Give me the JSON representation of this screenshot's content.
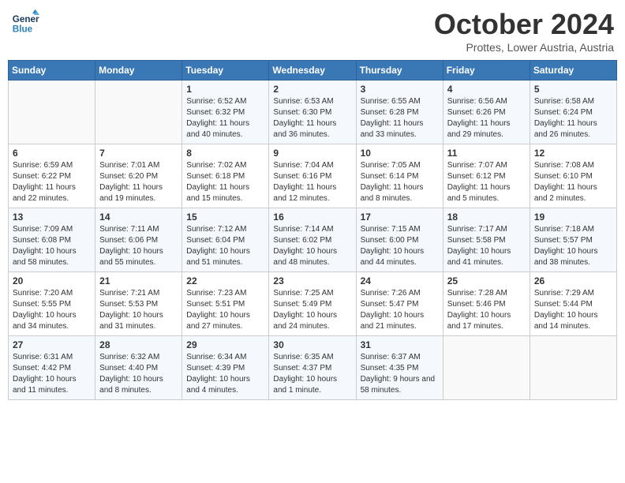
{
  "header": {
    "logo_general": "General",
    "logo_blue": "Blue",
    "month_title": "October 2024",
    "location": "Prottes, Lower Austria, Austria"
  },
  "weekdays": [
    "Sunday",
    "Monday",
    "Tuesday",
    "Wednesday",
    "Thursday",
    "Friday",
    "Saturday"
  ],
  "weeks": [
    [
      {
        "day": "",
        "sunrise": "",
        "sunset": "",
        "daylight": ""
      },
      {
        "day": "",
        "sunrise": "",
        "sunset": "",
        "daylight": ""
      },
      {
        "day": "1",
        "sunrise": "Sunrise: 6:52 AM",
        "sunset": "Sunset: 6:32 PM",
        "daylight": "Daylight: 11 hours and 40 minutes."
      },
      {
        "day": "2",
        "sunrise": "Sunrise: 6:53 AM",
        "sunset": "Sunset: 6:30 PM",
        "daylight": "Daylight: 11 hours and 36 minutes."
      },
      {
        "day": "3",
        "sunrise": "Sunrise: 6:55 AM",
        "sunset": "Sunset: 6:28 PM",
        "daylight": "Daylight: 11 hours and 33 minutes."
      },
      {
        "day": "4",
        "sunrise": "Sunrise: 6:56 AM",
        "sunset": "Sunset: 6:26 PM",
        "daylight": "Daylight: 11 hours and 29 minutes."
      },
      {
        "day": "5",
        "sunrise": "Sunrise: 6:58 AM",
        "sunset": "Sunset: 6:24 PM",
        "daylight": "Daylight: 11 hours and 26 minutes."
      }
    ],
    [
      {
        "day": "6",
        "sunrise": "Sunrise: 6:59 AM",
        "sunset": "Sunset: 6:22 PM",
        "daylight": "Daylight: 11 hours and 22 minutes."
      },
      {
        "day": "7",
        "sunrise": "Sunrise: 7:01 AM",
        "sunset": "Sunset: 6:20 PM",
        "daylight": "Daylight: 11 hours and 19 minutes."
      },
      {
        "day": "8",
        "sunrise": "Sunrise: 7:02 AM",
        "sunset": "Sunset: 6:18 PM",
        "daylight": "Daylight: 11 hours and 15 minutes."
      },
      {
        "day": "9",
        "sunrise": "Sunrise: 7:04 AM",
        "sunset": "Sunset: 6:16 PM",
        "daylight": "Daylight: 11 hours and 12 minutes."
      },
      {
        "day": "10",
        "sunrise": "Sunrise: 7:05 AM",
        "sunset": "Sunset: 6:14 PM",
        "daylight": "Daylight: 11 hours and 8 minutes."
      },
      {
        "day": "11",
        "sunrise": "Sunrise: 7:07 AM",
        "sunset": "Sunset: 6:12 PM",
        "daylight": "Daylight: 11 hours and 5 minutes."
      },
      {
        "day": "12",
        "sunrise": "Sunrise: 7:08 AM",
        "sunset": "Sunset: 6:10 PM",
        "daylight": "Daylight: 11 hours and 2 minutes."
      }
    ],
    [
      {
        "day": "13",
        "sunrise": "Sunrise: 7:09 AM",
        "sunset": "Sunset: 6:08 PM",
        "daylight": "Daylight: 10 hours and 58 minutes."
      },
      {
        "day": "14",
        "sunrise": "Sunrise: 7:11 AM",
        "sunset": "Sunset: 6:06 PM",
        "daylight": "Daylight: 10 hours and 55 minutes."
      },
      {
        "day": "15",
        "sunrise": "Sunrise: 7:12 AM",
        "sunset": "Sunset: 6:04 PM",
        "daylight": "Daylight: 10 hours and 51 minutes."
      },
      {
        "day": "16",
        "sunrise": "Sunrise: 7:14 AM",
        "sunset": "Sunset: 6:02 PM",
        "daylight": "Daylight: 10 hours and 48 minutes."
      },
      {
        "day": "17",
        "sunrise": "Sunrise: 7:15 AM",
        "sunset": "Sunset: 6:00 PM",
        "daylight": "Daylight: 10 hours and 44 minutes."
      },
      {
        "day": "18",
        "sunrise": "Sunrise: 7:17 AM",
        "sunset": "Sunset: 5:58 PM",
        "daylight": "Daylight: 10 hours and 41 minutes."
      },
      {
        "day": "19",
        "sunrise": "Sunrise: 7:18 AM",
        "sunset": "Sunset: 5:57 PM",
        "daylight": "Daylight: 10 hours and 38 minutes."
      }
    ],
    [
      {
        "day": "20",
        "sunrise": "Sunrise: 7:20 AM",
        "sunset": "Sunset: 5:55 PM",
        "daylight": "Daylight: 10 hours and 34 minutes."
      },
      {
        "day": "21",
        "sunrise": "Sunrise: 7:21 AM",
        "sunset": "Sunset: 5:53 PM",
        "daylight": "Daylight: 10 hours and 31 minutes."
      },
      {
        "day": "22",
        "sunrise": "Sunrise: 7:23 AM",
        "sunset": "Sunset: 5:51 PM",
        "daylight": "Daylight: 10 hours and 27 minutes."
      },
      {
        "day": "23",
        "sunrise": "Sunrise: 7:25 AM",
        "sunset": "Sunset: 5:49 PM",
        "daylight": "Daylight: 10 hours and 24 minutes."
      },
      {
        "day": "24",
        "sunrise": "Sunrise: 7:26 AM",
        "sunset": "Sunset: 5:47 PM",
        "daylight": "Daylight: 10 hours and 21 minutes."
      },
      {
        "day": "25",
        "sunrise": "Sunrise: 7:28 AM",
        "sunset": "Sunset: 5:46 PM",
        "daylight": "Daylight: 10 hours and 17 minutes."
      },
      {
        "day": "26",
        "sunrise": "Sunrise: 7:29 AM",
        "sunset": "Sunset: 5:44 PM",
        "daylight": "Daylight: 10 hours and 14 minutes."
      }
    ],
    [
      {
        "day": "27",
        "sunrise": "Sunrise: 6:31 AM",
        "sunset": "Sunset: 4:42 PM",
        "daylight": "Daylight: 10 hours and 11 minutes."
      },
      {
        "day": "28",
        "sunrise": "Sunrise: 6:32 AM",
        "sunset": "Sunset: 4:40 PM",
        "daylight": "Daylight: 10 hours and 8 minutes."
      },
      {
        "day": "29",
        "sunrise": "Sunrise: 6:34 AM",
        "sunset": "Sunset: 4:39 PM",
        "daylight": "Daylight: 10 hours and 4 minutes."
      },
      {
        "day": "30",
        "sunrise": "Sunrise: 6:35 AM",
        "sunset": "Sunset: 4:37 PM",
        "daylight": "Daylight: 10 hours and 1 minute."
      },
      {
        "day": "31",
        "sunrise": "Sunrise: 6:37 AM",
        "sunset": "Sunset: 4:35 PM",
        "daylight": "Daylight: 9 hours and 58 minutes."
      },
      {
        "day": "",
        "sunrise": "",
        "sunset": "",
        "daylight": ""
      },
      {
        "day": "",
        "sunrise": "",
        "sunset": "",
        "daylight": ""
      }
    ]
  ]
}
